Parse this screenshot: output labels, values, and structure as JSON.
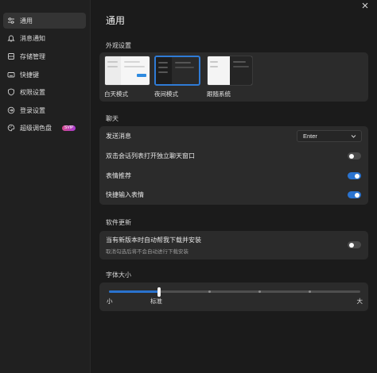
{
  "sidebar": {
    "items": [
      {
        "label": "通用",
        "icon": "sliders-icon"
      },
      {
        "label": "消息通知",
        "icon": "bell-icon"
      },
      {
        "label": "存储管理",
        "icon": "storage-icon"
      },
      {
        "label": "快捷键",
        "icon": "keyboard-icon"
      },
      {
        "label": "权限设置",
        "icon": "shield-icon"
      },
      {
        "label": "登录设置",
        "icon": "login-icon"
      },
      {
        "label": "超级调色盘",
        "icon": "palette-icon",
        "badge": "SVIP"
      }
    ],
    "active_index": 0
  },
  "page": {
    "title": "通用"
  },
  "appearance": {
    "title": "外观设置",
    "options": [
      {
        "label": "白天模式"
      },
      {
        "label": "夜间模式"
      },
      {
        "label": "跟随系统"
      }
    ],
    "selected_index": 1
  },
  "chat": {
    "title": "聊天",
    "send_label": "发送消息",
    "send_value": "Enter",
    "double_click_label": "双击会话列表打开独立聊天窗口",
    "double_click_on": false,
    "emoji_recommend_label": "表情推荐",
    "emoji_recommend_on": true,
    "quick_emoji_label": "快捷输入表情",
    "quick_emoji_on": true
  },
  "update": {
    "title": "软件更新",
    "auto_label": "当有新版本时自动帮我下载并安装",
    "auto_sub": "取消勾选后将不会自动进行下载安装",
    "auto_on": false
  },
  "font": {
    "title": "字体大小",
    "min_label": "小",
    "mid_label": "标准",
    "max_label": "大",
    "steps": 6,
    "value_index": 1
  },
  "colors": {
    "accent": "#2a73cf",
    "badge_start": "#d64d8f",
    "badge_end": "#a83ad1"
  }
}
